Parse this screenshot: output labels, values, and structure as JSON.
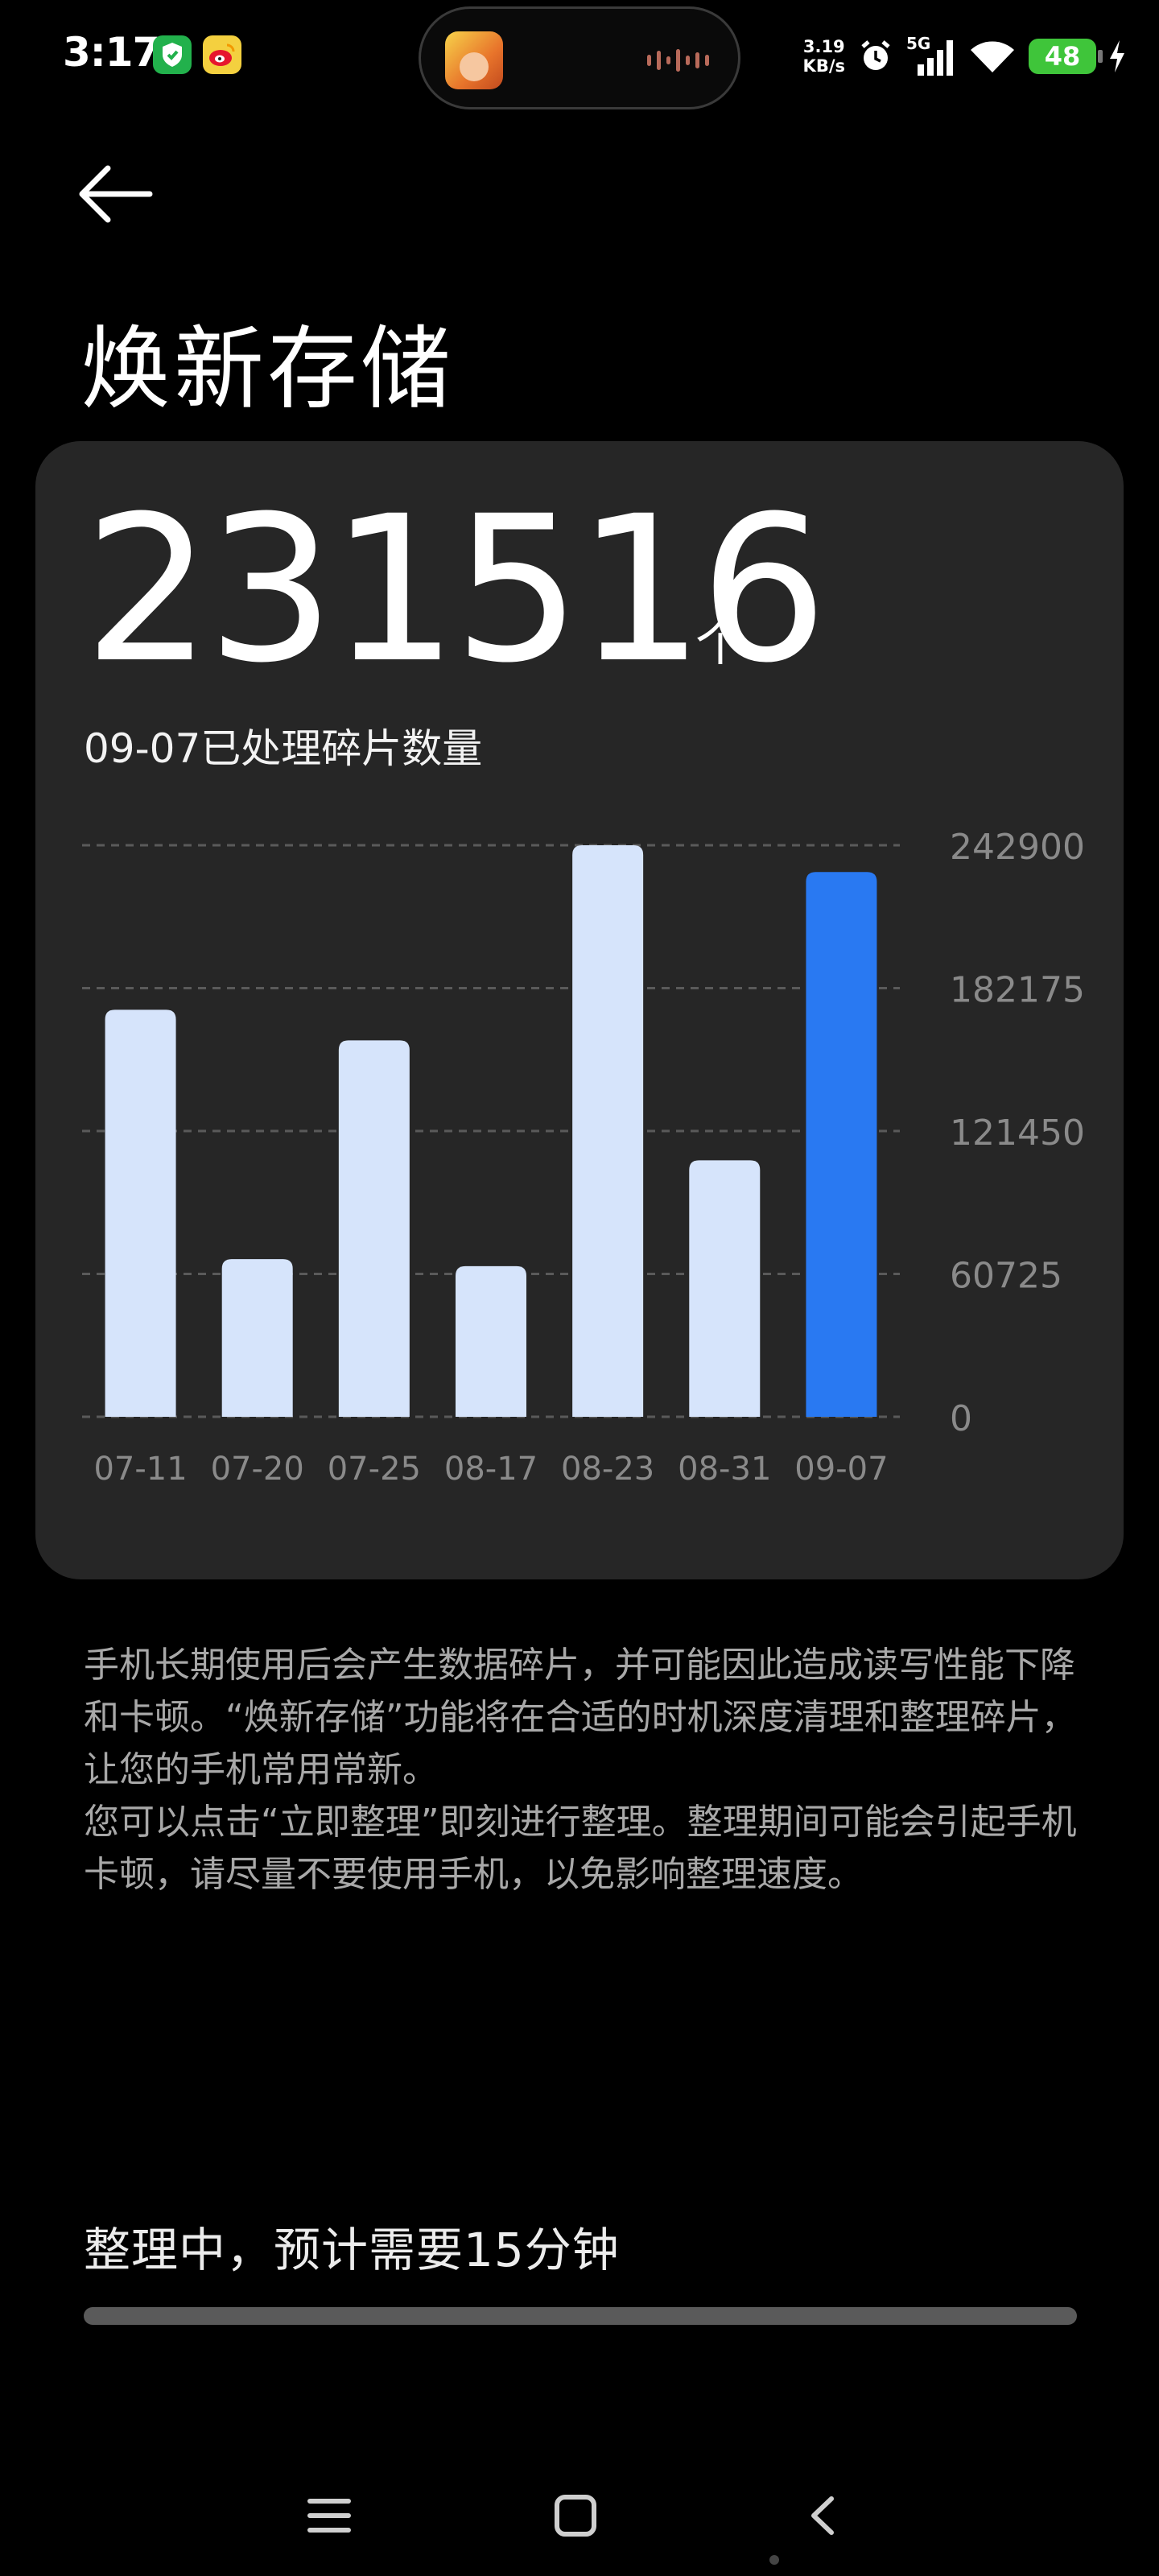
{
  "status_bar": {
    "time": "3:17",
    "net_speed_value": "3.19",
    "net_speed_unit": "KB/s",
    "network_type": "5G",
    "battery": "48",
    "icons": [
      "shield-icon",
      "weibo-icon",
      "alarm-icon",
      "signal-icon",
      "wifi-icon",
      "battery-icon",
      "charging-icon"
    ]
  },
  "header": {
    "title": "焕新存储"
  },
  "summary": {
    "count": "231516",
    "unit": "个",
    "subtitle": "09-07已处理碎片数量"
  },
  "colors": {
    "bar_default": "#d6e4fb",
    "bar_highlight": "#2979f2",
    "card_bg": "#262626",
    "grid": "#5a5a5a",
    "axis_text": "#8a8a8a"
  },
  "chart_data": {
    "type": "bar",
    "categories": [
      "07-11",
      "07-20",
      "07-25",
      "08-17",
      "08-23",
      "08-31",
      "09-07"
    ],
    "values": [
      173000,
      67000,
      160000,
      64000,
      242900,
      109000,
      231516
    ],
    "highlight_index": 6,
    "ylim": [
      0,
      242900
    ],
    "y_ticks": [
      "242900",
      "182175",
      "121450",
      "60725",
      "0"
    ],
    "grid": true,
    "title": "",
    "xlabel": "",
    "ylabel": ""
  },
  "description": {
    "paragraph1": "手机长期使用后会产生数据碎片，并可能因此造成读写性能下降和卡顿。“焕新存储”功能将在合适的时机深度清理和整理碎片，让您的手机常用常新。",
    "paragraph2": "您可以点击“立即整理”即刻进行整理。整理期间可能会引起手机卡顿，请尽量不要使用手机，以免影响整理速度。"
  },
  "progress": {
    "label": "整理中，预计需要15分钟",
    "fraction": 0.0
  },
  "nav_bar": {
    "buttons": [
      "menu-icon",
      "home-icon",
      "back-icon"
    ]
  }
}
